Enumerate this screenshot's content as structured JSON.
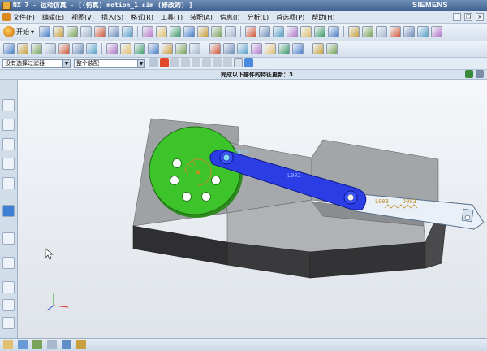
{
  "window": {
    "title": "NX 7 - 运动仿真 - [(仿真) motion_1.sim (修改的) ]",
    "brand": "SIEMENS"
  },
  "menu": {
    "items": [
      "文件(F)",
      "编辑(E)",
      "视图(V)",
      "插入(S)",
      "格式(R)",
      "工具(T)",
      "装配(A)",
      "信息(I)",
      "分析(L)",
      "首选项(P)",
      "帮助(H)"
    ]
  },
  "toolbar": {
    "start_label": "开始",
    "icons_row1": [
      "save-icon",
      "cut-icon",
      "copy-icon",
      "paste-icon",
      "delete-icon",
      "undo-icon",
      "redo-icon",
      "command-finder-icon",
      "function-icon",
      "sketch-icon",
      "edit-icon",
      "layer-icon",
      "rotate-icon",
      "zoom-window-icon",
      "pan-icon",
      "zoom-icon",
      "fit-icon",
      "refresh-icon",
      "perspective-icon",
      "shaded-icon",
      "view-orient-icon",
      "render-style-icon",
      "motion-joint-icon",
      "link-icon",
      "marker-icon",
      "spring-icon",
      "damper-icon",
      "contact-icon"
    ],
    "icons_row2": [
      "link-body-icon",
      "joint-icon",
      "coupler-icon",
      "gear-icon",
      "rack-icon",
      "cable-icon",
      "constraint-icon",
      "marker2-icon",
      "point-icon",
      "vector-icon",
      "measure-icon",
      "trace-icon",
      "interference-icon",
      "solver-icon",
      "animation-icon",
      "graph-icon",
      "skip-start-icon",
      "step-back-icon",
      "play-back-icon",
      "pause-icon",
      "play-icon",
      "step-forward-icon",
      "skip-end-icon"
    ]
  },
  "filter": {
    "type_filter": "没有选择过滤器",
    "scope": "整个装配"
  },
  "status": {
    "cue": "完成以下部件的特征更新：3"
  },
  "viewport": {
    "labels": {
      "link_002": "L002",
      "link_003": "L003",
      "joint_on_crank": "J002",
      "joint_slider": "J003"
    },
    "colors": {
      "crank": "#3cc42a",
      "connecting_rod": "#2a3fe0",
      "slider": "#e8f0f8",
      "housing_top": "#9ea1a4",
      "housing_side": "#2e2e30"
    }
  }
}
